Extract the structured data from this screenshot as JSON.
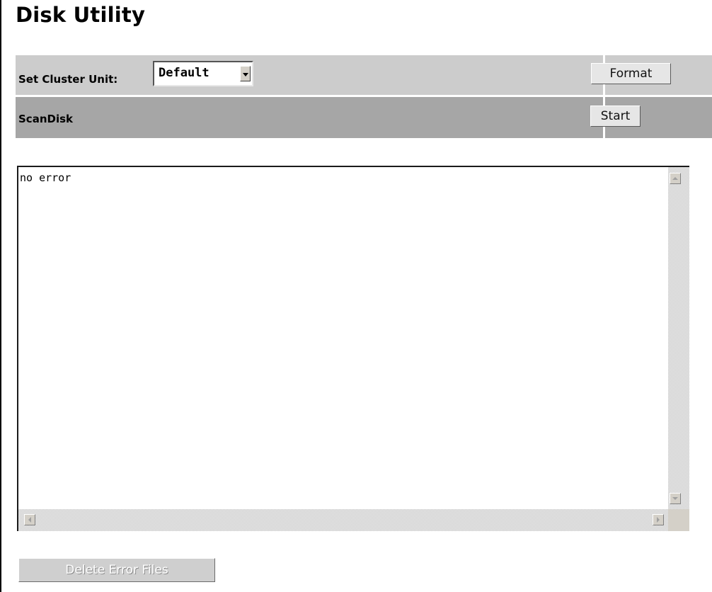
{
  "page": {
    "title": "Disk Utility"
  },
  "cluster": {
    "label": "Set Cluster Unit:",
    "selected": "Default",
    "format_button": "Format"
  },
  "scandisk": {
    "label": "ScanDisk",
    "start_button": "Start"
  },
  "log": {
    "text": "no error"
  },
  "actions": {
    "delete_button": "Delete Error Files",
    "delete_enabled": false
  },
  "colors": {
    "row1_bg": "#cccccc",
    "row2_bg": "#a6a6a6"
  },
  "icons": [
    "dropdown-arrow-icon",
    "scroll-up-icon",
    "scroll-down-icon",
    "scroll-left-icon",
    "scroll-right-icon"
  ]
}
